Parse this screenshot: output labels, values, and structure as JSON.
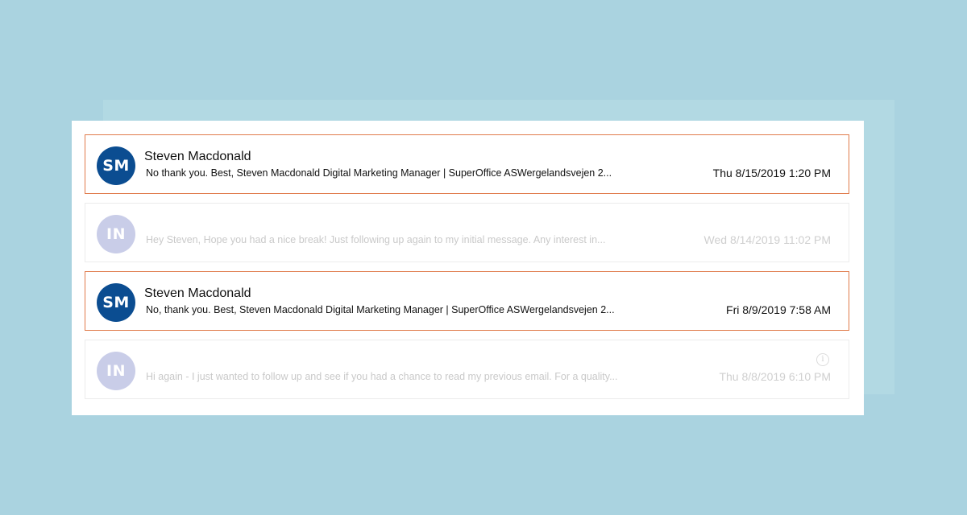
{
  "emails": [
    {
      "initials": "SM",
      "sender": "Steven Macdonald",
      "preview": "No thank you. Best, Steven Macdonald Digital Marketing Manager | SuperOffice ASWergelandsvejen 2...",
      "date": "Thu 8/15/2019 1:20 PM",
      "selected": true
    },
    {
      "initials": "IN",
      "sender": "",
      "preview": "Hey Steven, Hope you had a nice break! Just following up again to my initial message. Any interest in...",
      "date": "Wed 8/14/2019 11:02 PM",
      "selected": false
    },
    {
      "initials": "SM",
      "sender": "Steven Macdonald",
      "preview": "No, thank you. Best, Steven Macdonald Digital Marketing Manager | SuperOffice ASWergelandsvejen 2...",
      "date": "Fri 8/9/2019 7:58 AM",
      "selected": true
    },
    {
      "initials": "IN",
      "sender": "",
      "preview": "Hi again - I just wanted to follow up and see if you had a chance to read my previous email. For a quality...",
      "date": "Thu 8/8/2019 6:10 PM",
      "selected": false,
      "info_icon": "i"
    }
  ],
  "colors": {
    "background": "#aad3e0",
    "avatar_sm": "#0b4d91",
    "avatar_in": "#c9cde8",
    "selected_border": "#e07b4b"
  },
  "icons": {
    "info": "info-icon"
  }
}
